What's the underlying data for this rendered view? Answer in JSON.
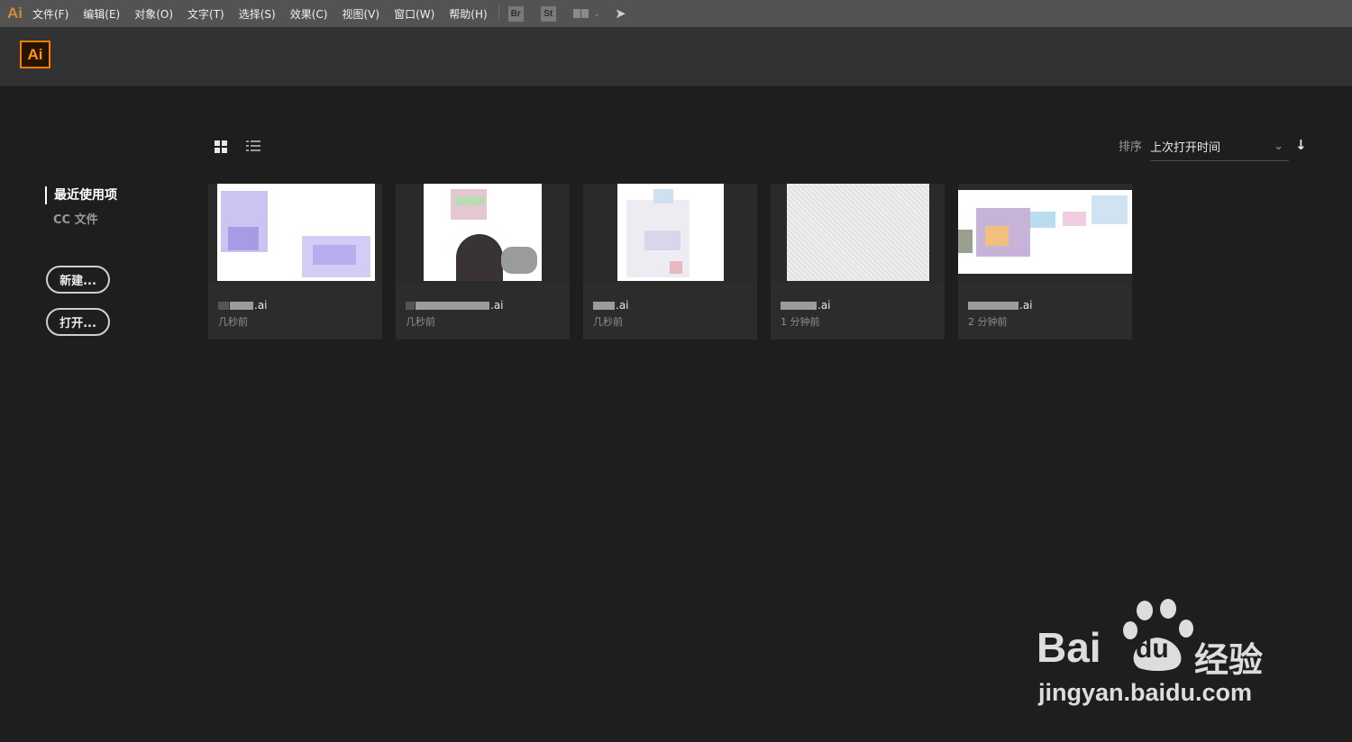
{
  "menubar": {
    "app_glyph": "Ai",
    "items": [
      "文件(F)",
      "编辑(E)",
      "对象(O)",
      "文字(T)",
      "选择(S)",
      "效果(C)",
      "视图(V)",
      "窗口(W)",
      "帮助(H)"
    ],
    "bridge_label": "Br",
    "stock_label": "St"
  },
  "header": {
    "logo": "Ai"
  },
  "nav": {
    "recent": "最近使用项",
    "cc_files": "CC 文件",
    "new_button": "新建...",
    "open_button": "打开..."
  },
  "sort": {
    "label": "排序",
    "value": "上次打开时间"
  },
  "files": [
    {
      "name_suffix": ".ai",
      "time": "几秒前"
    },
    {
      "name_suffix": ".ai",
      "time": "几秒前"
    },
    {
      "name_suffix": ".ai",
      "time": "几秒前"
    },
    {
      "name_suffix": ".ai",
      "time": "1 分钟前"
    },
    {
      "name_suffix": ".ai",
      "time": "2 分钟前"
    }
  ],
  "watermark": {
    "brand": "Bai",
    "brand_tail": "du",
    "product": "经验",
    "url": "jingyan.baidu.com"
  },
  "colors": {
    "menubar_bg": "#535353",
    "header_bg": "#323232",
    "canvas_bg": "#1e1e1e",
    "accent_orange": "#ff7c00"
  }
}
